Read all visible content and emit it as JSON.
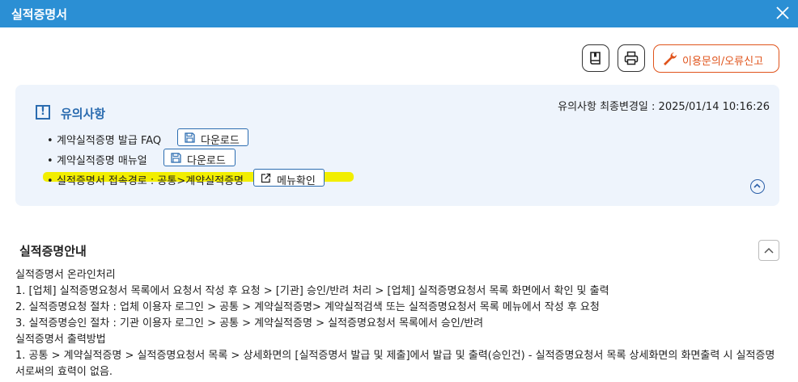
{
  "window": {
    "title": "실적증명서"
  },
  "toolbar": {
    "inquiry_label": "이용문의/오류신고"
  },
  "notice": {
    "title": "유의사항",
    "mark": "!",
    "last_updated": "유의사항 최종변경일 : 2025/01/14 10:16:26",
    "items": [
      {
        "text": "계약실적증명 발급 FAQ",
        "button": "다운로드"
      },
      {
        "text": "계약실적증명 매뉴얼",
        "button": "다운로드"
      },
      {
        "text": "실적증명서 접속경로 : 공통>계약실적증명",
        "button": "메뉴확인"
      }
    ],
    "bullet": "•"
  },
  "guide": {
    "title": "실적증명안내",
    "lines": [
      "실적증명서 온라인처리",
      "1. [업체] 실적증명요청서 목록에서 요청서 작성 후 요청 > [기관] 승인/반려 처리 > [업체] 실적증명요청서 목록 화면에서 확인 및 출력",
      "2. 실적증명요청 절차 : 업체 이용자 로그인 > 공통 > 계약실적증명> 계약실적검색 또는 실적증명요청서 목록 메뉴에서 작성 후 요청",
      "3. 실적증명승인 절차 : 기관 이용자 로그인 > 공통 > 계약실적증명 > 실적증명요청서 목록에서 승인/반려",
      "실적증명서 출력방법",
      "1. 공통 > 계약실적증명 > 실적증명요청서 목록 > 상세화면의 [실적증명서 발급 및 제출]에서 발급 및 출력(승인건) - 실적증명요청서 목록 상세화면의 화면출력 시 실적증명서로써의 효력이 없음."
    ]
  }
}
